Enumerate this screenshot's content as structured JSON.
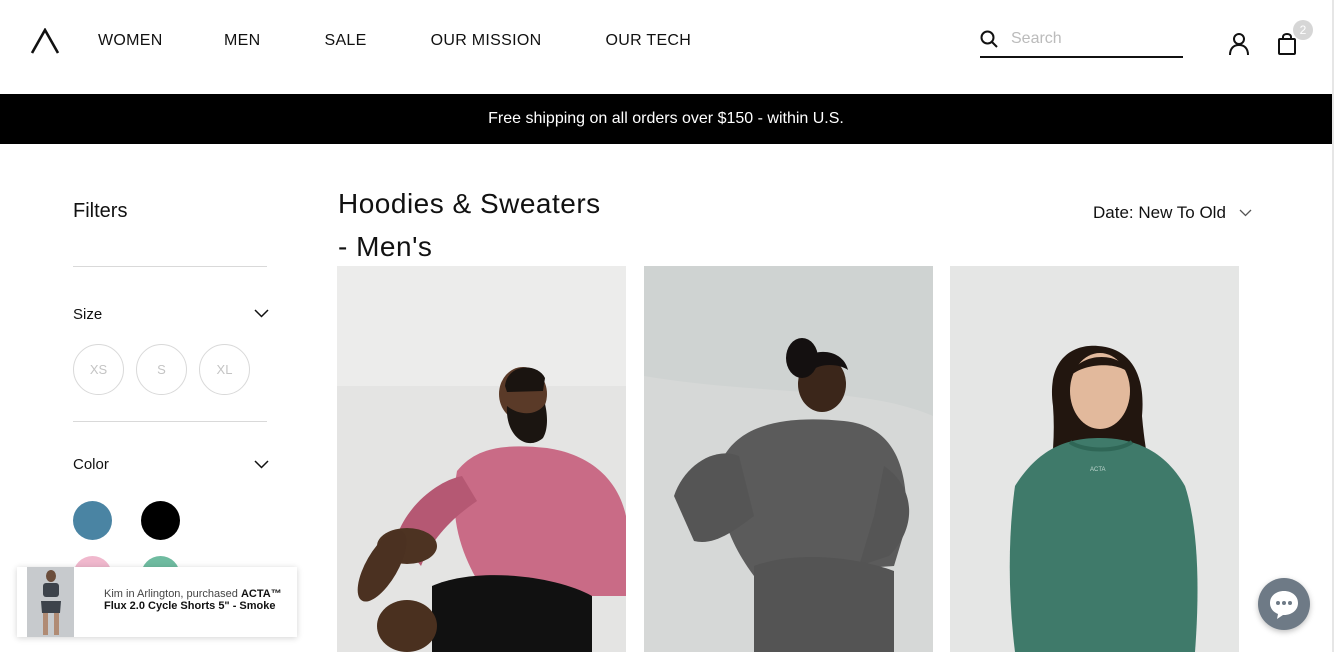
{
  "header": {
    "logo_icon": "acta-logo-icon",
    "nav": [
      "WOMEN",
      "MEN",
      "SALE",
      "OUR MISSION",
      "OUR TECH"
    ],
    "search_placeholder": "Search",
    "cart_count": "2"
  },
  "promo": {
    "text": "Free shipping on all orders over $150 - within U.S."
  },
  "filters": {
    "title": "Filters",
    "size": {
      "label": "Size",
      "options": [
        "XS",
        "S",
        "XL"
      ]
    },
    "color": {
      "label": "Color",
      "swatches": [
        "#4a84a3",
        "#000000",
        "#f0b8cd",
        "#6fbba0"
      ]
    }
  },
  "main": {
    "title": "Hoodies & Sweaters - Men's",
    "sort_label": "Date: New To Old"
  },
  "products": [
    {
      "color": "#c96b86"
    },
    {
      "color": "#5b5b5b"
    },
    {
      "color": "#3f7a6a"
    }
  ],
  "toast": {
    "who": "Kim in Arlington, purchased",
    "product": "ACTA™ Flux 2.0 Cycle Shorts 5\" - Smoke"
  }
}
